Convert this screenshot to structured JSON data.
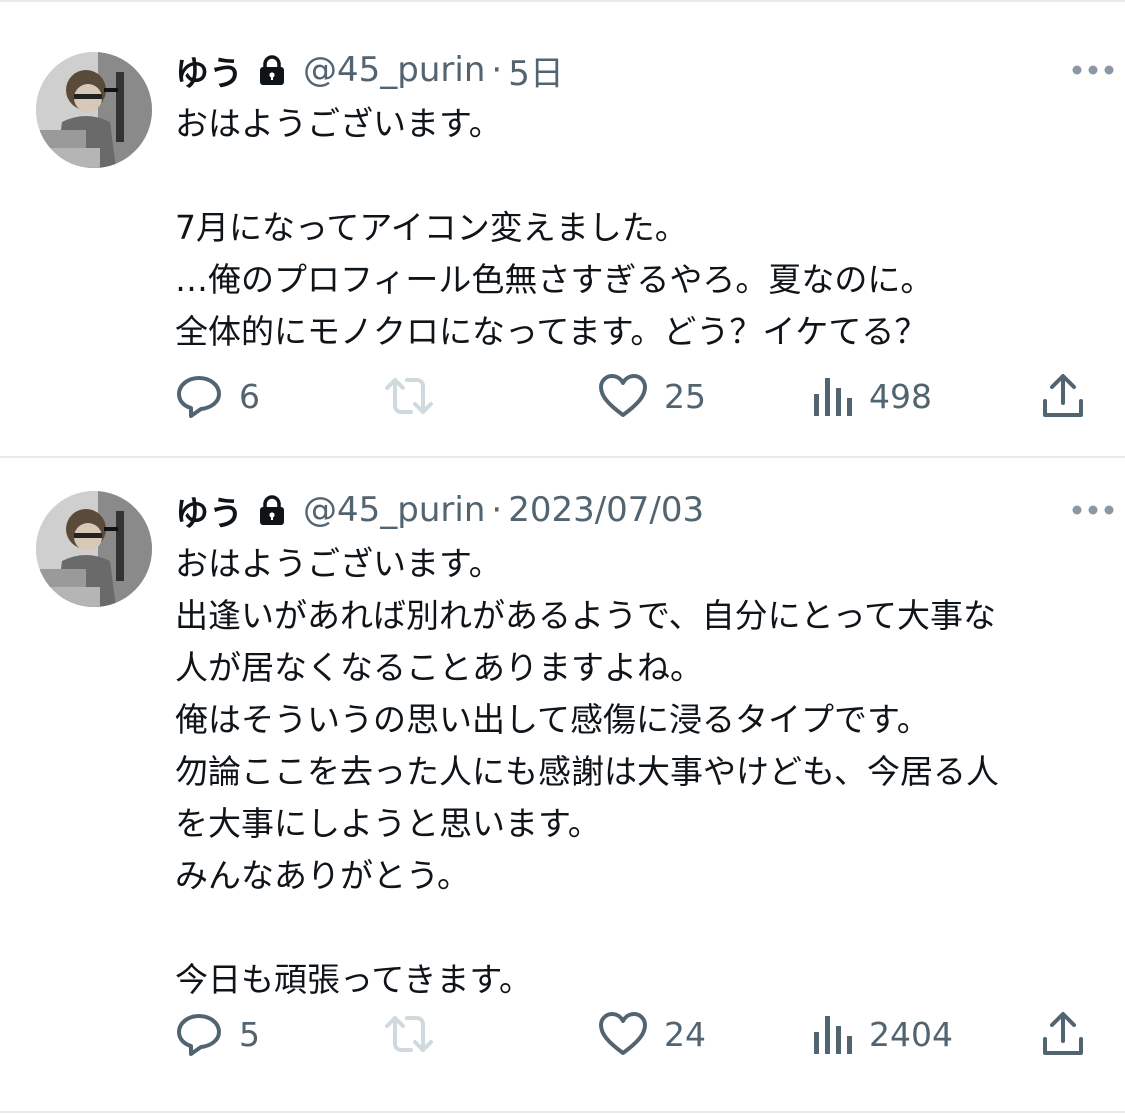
{
  "tweets": [
    {
      "author": {
        "display_name": "ゆう",
        "handle": "@45_purin"
      },
      "separator": "·",
      "timestamp": "5日",
      "text": "おはようございます。\n\n7月になってアイコン変えました。\n…俺のプロフィール色無さすぎるやろ。夏なのに。\n全体的にモノクロになってます。どう？イケてる？",
      "stats": {
        "replies": "6",
        "likes": "25",
        "views": "498"
      }
    },
    {
      "author": {
        "display_name": "ゆう",
        "handle": "@45_purin"
      },
      "separator": "·",
      "timestamp": "2023/07/03",
      "text": "おはようございます。\n出逢いがあれば別れがあるようで、自分にとって大事な\n人が居なくなることありますよね。\n俺はそういうの思い出して感傷に浸るタイプです。\n勿論ここを去った人にも感謝は大事やけども、今居る人\nを大事にしようと思います。\nみんなありがとう。\n\n今日も頑張ってきます。",
      "stats": {
        "replies": "5",
        "likes": "24",
        "views": "2404"
      }
    }
  ],
  "icons": {
    "lock": "lock-icon",
    "more": "more-icon",
    "reply": "reply-icon",
    "retweet": "retweet-icon",
    "like": "heart-icon",
    "views": "views-icon",
    "share": "share-icon"
  },
  "colors": {
    "text_primary": "#0f1419",
    "text_secondary": "#536471",
    "retweet_disabled": "#cfd9de",
    "divider": "#e7e9ea"
  }
}
